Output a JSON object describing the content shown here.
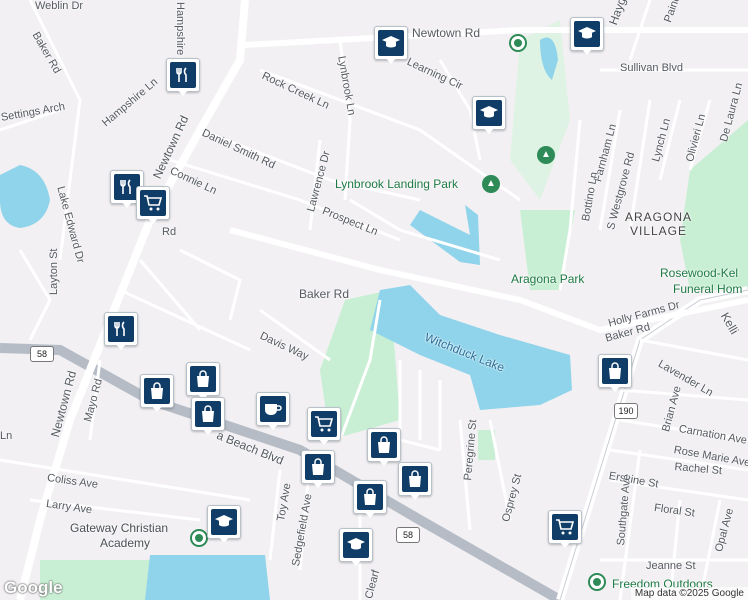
{
  "map": {
    "attribution": "Map data ©2025 Google",
    "logo": "Google"
  },
  "labels": {
    "streets": [
      "Weblin Dr",
      "Hampshire Ln",
      "Baker Rd",
      "Newtown Rd",
      "Lynbrook Ln",
      "Rock Creek Ln",
      "Learning Cir",
      "Sullivan Blvd",
      "Haygood",
      "Paine",
      "Hampshire Ln",
      "Daniel Smith Rd",
      "Connie Ln",
      "Lawrence Dr",
      "Prospect Ln",
      "Lake Edward Dr",
      "Newtown Rd",
      "Farnham Ln",
      "Lynch Ln",
      "Olivieri Ln",
      "De Laura Ln",
      "Bottino Ln",
      "S Westgrove Rd",
      "Baker Rd",
      "Holly Farms Dr",
      "Baker Rd",
      "Layton St",
      "Davis Way",
      "Lavender Ln",
      "Mayo Rd",
      "Newtown Rd",
      "Brian Ave",
      "Carnation Ave",
      "Rose Marie Ave",
      "Rachel St",
      "Erskine St",
      "Peregrine St",
      "Coliss Ave",
      "Larry Ave",
      "Toy Ave",
      "Sedgefield Ave",
      "Osprey St",
      "Southgate Ave",
      "Floral St",
      "Opal Ave",
      "Jeanne St",
      "Clearf",
      "a Beach Blvd",
      "Kelli",
      "Ln",
      "Settings Arch",
      "Rd"
    ],
    "places": [
      "ARAGONA",
      "VILLAGE"
    ],
    "parks": [
      "Lynbrook Landing Park",
      "Aragona Park"
    ],
    "water": [
      "Witchduck Lake"
    ],
    "pois": [
      "Rosewood-Kel",
      "Funeral Hom",
      "Gateway Christian",
      "Academy",
      "Freedom Outdoors"
    ],
    "route_shields": [
      "58",
      "190",
      "58"
    ]
  },
  "markers": [
    {
      "type": "restaurant",
      "icon": "fork-knife-icon"
    },
    {
      "type": "restaurant",
      "icon": "fork-knife-icon"
    },
    {
      "type": "restaurant",
      "icon": "fork-knife-icon"
    },
    {
      "type": "grocery",
      "icon": "shopping-cart-icon"
    },
    {
      "type": "grocery",
      "icon": "shopping-cart-icon"
    },
    {
      "type": "grocery",
      "icon": "shopping-cart-icon"
    },
    {
      "type": "school",
      "icon": "graduation-cap-icon"
    },
    {
      "type": "school",
      "icon": "graduation-cap-icon"
    },
    {
      "type": "school",
      "icon": "graduation-cap-icon"
    },
    {
      "type": "school",
      "icon": "graduation-cap-icon"
    },
    {
      "type": "school",
      "icon": "graduation-cap-icon"
    },
    {
      "type": "shopping",
      "icon": "shopping-bag-icon"
    },
    {
      "type": "shopping",
      "icon": "shopping-bag-icon"
    },
    {
      "type": "shopping",
      "icon": "shopping-bag-icon"
    },
    {
      "type": "shopping",
      "icon": "shopping-bag-icon"
    },
    {
      "type": "shopping",
      "icon": "shopping-bag-icon"
    },
    {
      "type": "shopping",
      "icon": "shopping-bag-icon"
    },
    {
      "type": "shopping",
      "icon": "shopping-bag-icon"
    },
    {
      "type": "shopping",
      "icon": "shopping-bag-icon"
    },
    {
      "type": "cafe",
      "icon": "coffee-cup-icon"
    }
  ],
  "colors": {
    "background": "#f2f0f3",
    "road": "#ffffff",
    "highway": "#b5bcc6",
    "water": "#8fd4ea",
    "park": "#c8efd4",
    "marker": "#0f3d68"
  }
}
